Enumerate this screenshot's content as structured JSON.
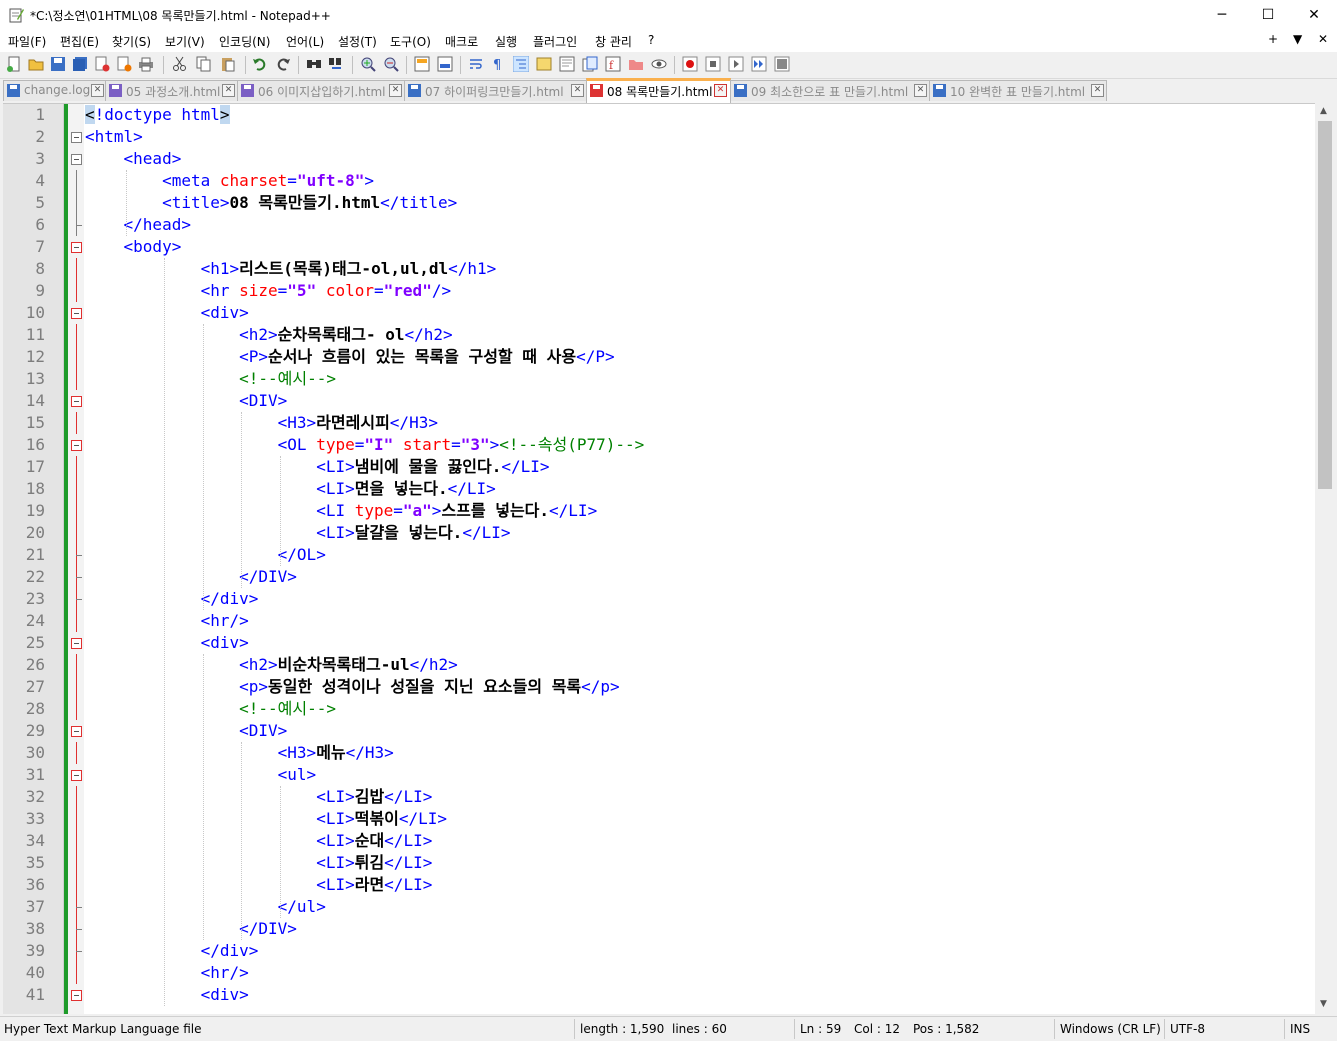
{
  "window": {
    "title": "*C:\\정소연\\01HTML\\08 목록만들기.html - Notepad++",
    "minimize": "─",
    "maximize": "☐",
    "close": "✕"
  },
  "menu": {
    "items": [
      "파일(F)",
      "편집(E)",
      "찾기(S)",
      "보기(V)",
      "인코딩(N)",
      "언어(L)",
      "설정(T)",
      "도구(O)",
      "매크로",
      "실행",
      "플러그인",
      "창 관리",
      "?"
    ],
    "right": [
      "+",
      "▼",
      "✕"
    ]
  },
  "tabs": [
    {
      "label": "change.log",
      "active": false
    },
    {
      "label": "05 과정소개.html",
      "active": false
    },
    {
      "label": "06 이미지삽입하기.html",
      "active": false
    },
    {
      "label": "07 하이퍼링크만들기.html",
      "active": false
    },
    {
      "label": "08 목록만들기.html",
      "active": true
    },
    {
      "label": "09 최소한으로 표 만들기.html",
      "active": false
    },
    {
      "label": "10 완벽한 표 만들기.html",
      "active": false
    }
  ],
  "editor": {
    "line_numbers": [
      "1",
      "2",
      "3",
      "4",
      "5",
      "6",
      "7",
      "8",
      "9",
      "10",
      "11",
      "12",
      "13",
      "14",
      "15",
      "16",
      "17",
      "18",
      "19",
      "20",
      "21",
      "22",
      "23",
      "24",
      "25",
      "26",
      "27",
      "28",
      "29",
      "30",
      "31",
      "32",
      "33",
      "34",
      "35",
      "36",
      "37",
      "38",
      "39",
      "40",
      "41"
    ],
    "lines": [
      [
        {
          "c": "hl",
          "t": "<"
        },
        {
          "c": "tg",
          "t": "!doctype html"
        },
        {
          "c": "hl",
          "t": ">"
        }
      ],
      [
        {
          "c": "tg",
          "t": "<html>"
        }
      ],
      [
        {
          "c": "tg",
          "t": "    <head>"
        }
      ],
      [
        {
          "c": "tg",
          "t": "        <meta "
        },
        {
          "c": "at",
          "t": "charset"
        },
        {
          "c": "tg",
          "t": "="
        },
        {
          "c": "av",
          "t": "\"uft-8\""
        },
        {
          "c": "tg",
          "t": ">"
        }
      ],
      [
        {
          "c": "tg",
          "t": "        <title>"
        },
        {
          "c": "tx",
          "t": "08 목록만들기.html"
        },
        {
          "c": "tg",
          "t": "</title>"
        }
      ],
      [
        {
          "c": "tg",
          "t": "    </head>"
        }
      ],
      [
        {
          "c": "tg",
          "t": "    <body>"
        }
      ],
      [
        {
          "c": "tg",
          "t": "            <h1>"
        },
        {
          "c": "tx",
          "t": "리스트(목록)태그-ol,ul,dl"
        },
        {
          "c": "tg",
          "t": "</h1>"
        }
      ],
      [
        {
          "c": "tg",
          "t": "            <hr "
        },
        {
          "c": "at",
          "t": "size"
        },
        {
          "c": "tg",
          "t": "="
        },
        {
          "c": "av",
          "t": "\"5\""
        },
        {
          "c": "tg",
          "t": " "
        },
        {
          "c": "at",
          "t": "color"
        },
        {
          "c": "tg",
          "t": "="
        },
        {
          "c": "av",
          "t": "\"red\""
        },
        {
          "c": "tg",
          "t": "/>"
        }
      ],
      [
        {
          "c": "tg",
          "t": "            <div>"
        }
      ],
      [
        {
          "c": "tg",
          "t": "                <h2>"
        },
        {
          "c": "tx",
          "t": "순차목록태그- ol"
        },
        {
          "c": "tg",
          "t": "</h2>"
        }
      ],
      [
        {
          "c": "tg",
          "t": "                <P>"
        },
        {
          "c": "tx",
          "t": "순서나 흐름이 있는 목록을 구성할 때 사용"
        },
        {
          "c": "tg",
          "t": "</P>"
        }
      ],
      [
        {
          "c": "cm",
          "t": "                <!--예시-->"
        }
      ],
      [
        {
          "c": "tg",
          "t": "                <DIV>"
        }
      ],
      [
        {
          "c": "tg",
          "t": "                    <H3>"
        },
        {
          "c": "tx",
          "t": "라면레시피"
        },
        {
          "c": "tg",
          "t": "</H3>"
        }
      ],
      [
        {
          "c": "tg",
          "t": "                    <OL "
        },
        {
          "c": "at",
          "t": "type"
        },
        {
          "c": "tg",
          "t": "="
        },
        {
          "c": "av",
          "t": "\"I\""
        },
        {
          "c": "tg",
          "t": " "
        },
        {
          "c": "at",
          "t": "start"
        },
        {
          "c": "tg",
          "t": "="
        },
        {
          "c": "av",
          "t": "\"3\""
        },
        {
          "c": "tg",
          "t": ">"
        },
        {
          "c": "cm",
          "t": "<!--속성(P77)-->"
        }
      ],
      [
        {
          "c": "tg",
          "t": "                        <LI>"
        },
        {
          "c": "tx",
          "t": "냄비에 물을 끓인다."
        },
        {
          "c": "tg",
          "t": "</LI>"
        }
      ],
      [
        {
          "c": "tg",
          "t": "                        <LI>"
        },
        {
          "c": "tx",
          "t": "면을 넣는다."
        },
        {
          "c": "tg",
          "t": "</LI>"
        }
      ],
      [
        {
          "c": "tg",
          "t": "                        <LI "
        },
        {
          "c": "at",
          "t": "type"
        },
        {
          "c": "tg",
          "t": "="
        },
        {
          "c": "av",
          "t": "\"a\""
        },
        {
          "c": "tg",
          "t": ">"
        },
        {
          "c": "tx",
          "t": "스프를 넣는다."
        },
        {
          "c": "tg",
          "t": "</LI>"
        }
      ],
      [
        {
          "c": "tg",
          "t": "                        <LI>"
        },
        {
          "c": "tx",
          "t": "달걀을 넣는다."
        },
        {
          "c": "tg",
          "t": "</LI>"
        }
      ],
      [
        {
          "c": "tg",
          "t": "                    </OL>"
        }
      ],
      [
        {
          "c": "tg",
          "t": "                </DIV>"
        }
      ],
      [
        {
          "c": "tg",
          "t": "            </div>"
        }
      ],
      [
        {
          "c": "tg",
          "t": "            <hr/>"
        }
      ],
      [
        {
          "c": "tg",
          "t": "            <div>"
        }
      ],
      [
        {
          "c": "tg",
          "t": "                <h2>"
        },
        {
          "c": "tx",
          "t": "비순차목록태그-ul"
        },
        {
          "c": "tg",
          "t": "</h2>"
        }
      ],
      [
        {
          "c": "tg",
          "t": "                <p>"
        },
        {
          "c": "tx",
          "t": "동일한 성격이나 성질을 지닌 요소들의 목록"
        },
        {
          "c": "tg",
          "t": "</p>"
        }
      ],
      [
        {
          "c": "cm",
          "t": "                <!--예시-->"
        }
      ],
      [
        {
          "c": "tg",
          "t": "                <DIV>"
        }
      ],
      [
        {
          "c": "tg",
          "t": "                    <H3>"
        },
        {
          "c": "tx",
          "t": "메뉴"
        },
        {
          "c": "tg",
          "t": "</H3>"
        }
      ],
      [
        {
          "c": "tg",
          "t": "                    <ul>"
        }
      ],
      [
        {
          "c": "tg",
          "t": "                        <LI>"
        },
        {
          "c": "tx",
          "t": "김밥"
        },
        {
          "c": "tg",
          "t": "</LI>"
        }
      ],
      [
        {
          "c": "tg",
          "t": "                        <LI>"
        },
        {
          "c": "tx",
          "t": "떡볶이"
        },
        {
          "c": "tg",
          "t": "</LI>"
        }
      ],
      [
        {
          "c": "tg",
          "t": "                        <LI>"
        },
        {
          "c": "tx",
          "t": "순대"
        },
        {
          "c": "tg",
          "t": "</LI>"
        }
      ],
      [
        {
          "c": "tg",
          "t": "                        <LI>"
        },
        {
          "c": "tx",
          "t": "튀김"
        },
        {
          "c": "tg",
          "t": "</LI>"
        }
      ],
      [
        {
          "c": "tg",
          "t": "                        <LI>"
        },
        {
          "c": "tx",
          "t": "라면"
        },
        {
          "c": "tg",
          "t": "</LI>"
        }
      ],
      [
        {
          "c": "tg",
          "t": "                    </ul>"
        }
      ],
      [
        {
          "c": "tg",
          "t": "                </DIV>"
        }
      ],
      [
        {
          "c": "tg",
          "t": "            </div>"
        }
      ],
      [
        {
          "c": "tg",
          "t": "            <hr/>"
        }
      ],
      [
        {
          "c": "tg",
          "t": "            <div>"
        }
      ]
    ]
  },
  "status": {
    "file_type": "Hyper Text Markup Language file",
    "length": "length : 1,590",
    "lines": "lines : 60",
    "ln": "Ln : 59",
    "col": "Col : 12",
    "pos": "Pos : 1,582",
    "eol": "Windows (CR LF)",
    "encoding": "UTF-8",
    "mode": "INS"
  },
  "colors": {
    "tag": "#0000ff",
    "attribute": "#ff0000",
    "attr_value": "#8000ff",
    "comment": "#008000",
    "change_bar": "#1e9b2a",
    "active_tab_accent": "#fab04d"
  }
}
